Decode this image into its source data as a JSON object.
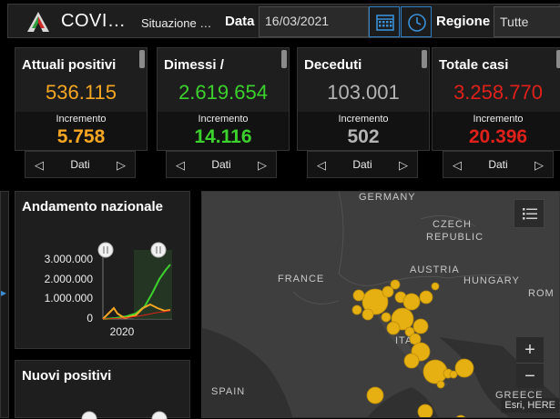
{
  "header": {
    "app_title": "COVI…",
    "subtitle": "Situazione …",
    "date_label": "Data",
    "date_value": "16/03/2021",
    "region_label": "Regione",
    "region_value": "Tutte",
    "calendar_icon": "calendar-icon",
    "clock_icon": "clock-icon"
  },
  "cards": [
    {
      "title": "Attuali positivi",
      "value": "536.115",
      "inc_label": "Incremento",
      "inc_value": "5.758",
      "color": "#f5a623",
      "pager": "Dati"
    },
    {
      "title": "Dimessi / ",
      "value": "2.619.654",
      "inc_label": "Incremento",
      "inc_value": "14.116",
      "color": "#3cd22d",
      "pager": "Dati"
    },
    {
      "title": "Deceduti",
      "value": "103.001",
      "inc_label": "Incremento",
      "inc_value": "502",
      "color": "#b4b4b4",
      "pager": "Dati"
    },
    {
      "title": "Totale casi",
      "value": "3.258.770",
      "inc_label": "Incremento",
      "inc_value": "20.396",
      "color": "#e0201a",
      "pager": "Dati"
    }
  ],
  "trend": {
    "title": "Andamento nazionale",
    "y_ticks": [
      "3.000.000",
      "2.000.000",
      "1.000.000",
      "0"
    ],
    "x_label": "2020"
  },
  "new_positives": {
    "title": "Nuovi positivi"
  },
  "map": {
    "labels": {
      "germany": "GERMANY",
      "czech": "CZECH",
      "republic": "REPUBLIC",
      "france": "FRANCE",
      "austria": "AUSTRIA",
      "hungary": "HUNGARY",
      "romania": "ROM",
      "italy": "ITA",
      "spain": "SPAIN",
      "greece": "GREECE"
    },
    "zoom_in": "+",
    "zoom_out": "−",
    "attribution": "Esri, HERE",
    "marker_color": "#e6b012"
  }
}
